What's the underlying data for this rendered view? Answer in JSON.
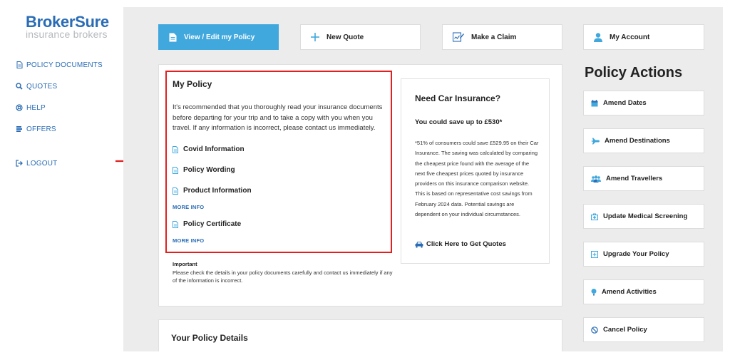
{
  "brand": {
    "name": "BrokerSure",
    "tagline": "insurance brokers"
  },
  "sidebar": {
    "items": [
      {
        "label": "POLICY DOCUMENTS",
        "icon": "document-icon"
      },
      {
        "label": "QUOTES",
        "icon": "search-icon"
      },
      {
        "label": "HELP",
        "icon": "help-icon"
      },
      {
        "label": "OFFERS",
        "icon": "offers-icon"
      }
    ],
    "logout": {
      "label": "LOGOUT",
      "icon": "logout-icon"
    }
  },
  "topnav": {
    "view_edit": "View / Edit my Policy",
    "new_quote": "New Quote",
    "make_claim": "Make a Claim",
    "my_account": "My Account"
  },
  "my_policy": {
    "title": "My Policy",
    "intro": "It's recommended that you thoroughly read your insurance documents before departing for your trip and to take a copy with you when you travel. If any information is incorrect, please contact us immediately.",
    "documents": [
      {
        "label": "Covid Information"
      },
      {
        "label": "Policy Wording"
      },
      {
        "label": "Product Information",
        "more": "MORE INFO"
      },
      {
        "label": "Policy Certificate",
        "more": "MORE INFO"
      }
    ],
    "important_title": "Important",
    "important_text": "Please check the details in your policy documents carefully and contact us immediately if any of the information is incorrect."
  },
  "car_insurance": {
    "title": "Need Car Insurance?",
    "subtitle": "You could save up to £530*",
    "disclaimer": "*51% of consumers could save £529.95 on their Car Insurance. The saving was calculated by comparing the cheapest price found with the average of the next five cheapest prices quoted by insurance providers on this insurance comparison website. This is based on representative cost savings from February 2024 data. Potential savings are dependent on your individual circumstances.",
    "cta": "Click Here to Get Quotes"
  },
  "policy_details": {
    "title": "Your Policy Details"
  },
  "policy_actions": {
    "title": "Policy Actions",
    "items": [
      {
        "label": "Amend Dates",
        "icon": "calendar-icon"
      },
      {
        "label": "Amend Destinations",
        "icon": "plane-icon"
      },
      {
        "label": "Amend Travellers",
        "icon": "users-icon"
      },
      {
        "label": "Update Medical Screening",
        "icon": "medical-icon"
      },
      {
        "label": "Upgrade Your Policy",
        "icon": "plus-square-icon"
      },
      {
        "label": "Amend Activities",
        "icon": "balloon-icon"
      },
      {
        "label": "Cancel Policy",
        "icon": "cancel-icon"
      }
    ]
  },
  "colors": {
    "accent": "#41a8dd",
    "brand": "#2a6cb5",
    "highlight": "#e2201f",
    "panel": "#ececec"
  }
}
